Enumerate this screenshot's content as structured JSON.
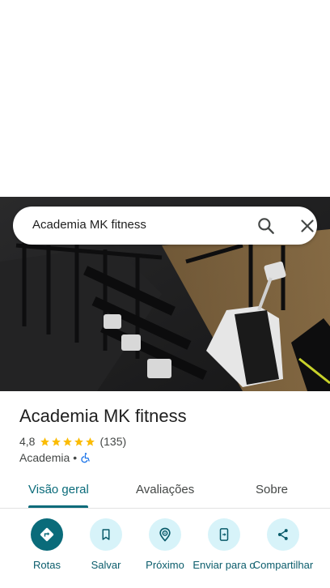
{
  "search": {
    "query": "Academia MK fitness"
  },
  "place": {
    "name": "Academia MK fitness",
    "rating": "4,8",
    "stars": 5,
    "review_count": "(135)",
    "category": "Academia",
    "separator": "•"
  },
  "tabs": [
    {
      "label": "Visão geral",
      "active": true
    },
    {
      "label": "Avaliações",
      "active": false
    },
    {
      "label": "Sobre",
      "active": false
    }
  ],
  "actions": [
    {
      "label": "Rotas",
      "icon": "directions-icon",
      "primary": true
    },
    {
      "label": "Salvar",
      "icon": "bookmark-icon",
      "primary": false
    },
    {
      "label": "Próximo",
      "icon": "nearby-icon",
      "primary": false
    },
    {
      "label": "Enviar para o",
      "icon": "send-to-phone-icon",
      "primary": false
    },
    {
      "label": "Compartilhar",
      "icon": "share-icon",
      "primary": false
    }
  ],
  "colors": {
    "accent": "#0a6b7a",
    "action_bg": "#d7f3f9",
    "star": "#fbbc04",
    "accessibility": "#1a73e8"
  }
}
